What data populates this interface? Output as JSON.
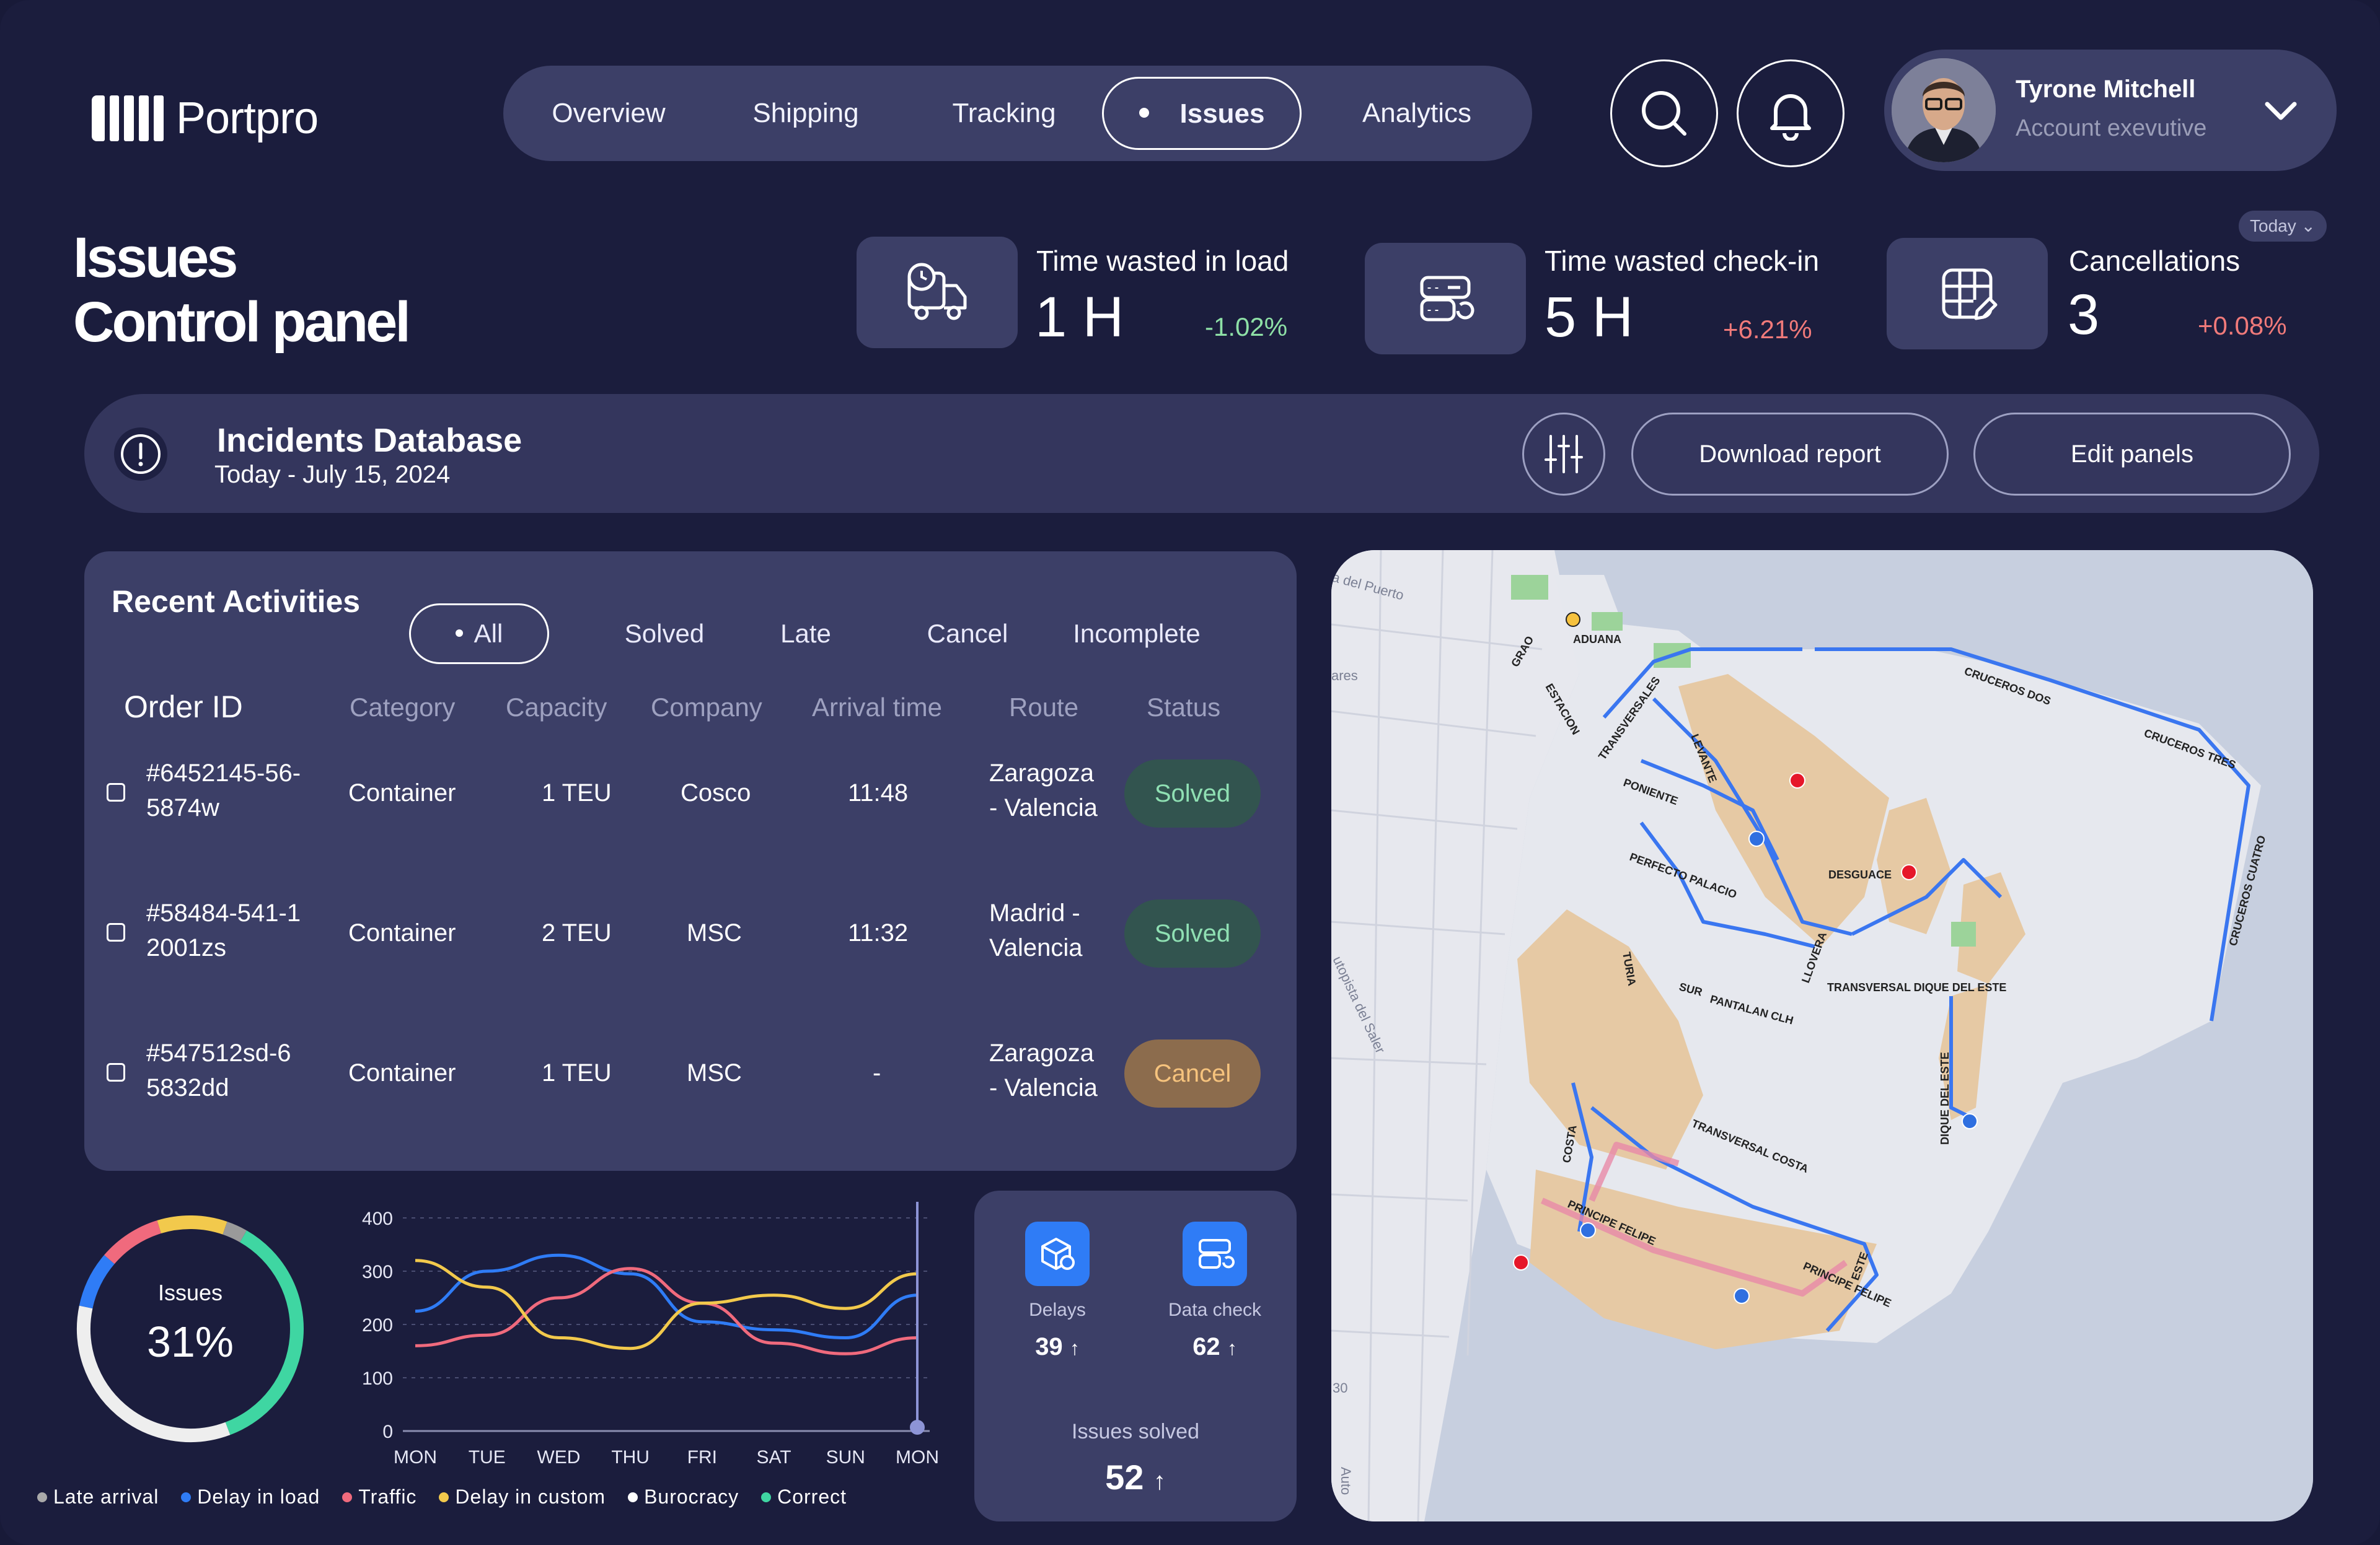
{
  "brand": {
    "name": "Portpro"
  },
  "nav": {
    "items": [
      {
        "label": "Overview"
      },
      {
        "label": "Shipping"
      },
      {
        "label": "Tracking"
      },
      {
        "label": "Issues",
        "active": true
      },
      {
        "label": "Analytics"
      }
    ]
  },
  "header": {
    "search_icon": "search-icon",
    "bell_icon": "bell-icon",
    "user": {
      "name": "Tyrone Mitchell",
      "role": "Account exevutive"
    }
  },
  "page": {
    "title_line1": "Issues",
    "title_line2": "Control panel"
  },
  "stats": {
    "period": "Today",
    "items": [
      {
        "label": "Time wasted in load",
        "value": "1 H",
        "change": "-1.02%",
        "icon": "truck-clock-icon",
        "change_color": "#8ee0a6"
      },
      {
        "label": "Time wasted check-in",
        "value": "5 H",
        "change": "+6.21%",
        "icon": "server-refresh-icon",
        "change_color": "#f07a7a"
      },
      {
        "label": "Cancellations",
        "value": "3",
        "change": "+0.08%",
        "icon": "grid-edit-icon",
        "change_color": "#f07a7a"
      }
    ]
  },
  "incidents": {
    "title": "Incidents Database",
    "subtitle": "Today - July 15, 2024",
    "download_label": "Download report",
    "edit_label": "Edit panels"
  },
  "activities": {
    "title": "Recent Activities",
    "filters": [
      "All",
      "Solved",
      "Late",
      "Cancel",
      "Incomplete"
    ],
    "columns": [
      "Order ID",
      "Category",
      "Capacity",
      "Company",
      "Arrival time",
      "Route",
      "Status"
    ],
    "rows": [
      {
        "id_line1": "#6452145-56-",
        "id_line2": "5874w",
        "category": "Container",
        "capacity": "1 TEU",
        "company": "Cosco",
        "arrival": "11:48",
        "route_line1": "Zaragoza",
        "route_line2": "- Valencia",
        "status": "Solved"
      },
      {
        "id_line1": "#58484-541-1",
        "id_line2": "2001zs",
        "category": "Container",
        "capacity": "2 TEU",
        "company": "MSC",
        "arrival": "11:32",
        "route_line1": "Madrid -",
        "route_line2": "Valencia",
        "status": "Solved"
      },
      {
        "id_line1": "#547512sd-6",
        "id_line2": "5832dd",
        "category": "Container",
        "capacity": "1 TEU",
        "company": "MSC",
        "arrival": "-",
        "route_line1": "Zaragoza",
        "route_line2": "- Valencia",
        "status": "Cancel"
      }
    ]
  },
  "issues_donut": {
    "label": "Issues",
    "value": "31%",
    "segments": [
      {
        "name": "Correct",
        "fraction": 0.36,
        "color": "#3fd6a2"
      },
      {
        "name": "Burocracy",
        "fraction": 0.34,
        "color": "#eeeeee"
      },
      {
        "name": "Delay in load",
        "fraction": 0.08,
        "color": "#2f7cf6"
      },
      {
        "name": "Traffic",
        "fraction": 0.09,
        "color": "#f06a7d"
      },
      {
        "name": "Delay in custom",
        "fraction": 0.1,
        "color": "#f2c94c"
      },
      {
        "name": "Late arrival",
        "fraction": 0.03,
        "color": "#9a9a9a"
      }
    ]
  },
  "legend": [
    {
      "label": "Late arrival",
      "color": "#a9a9a9"
    },
    {
      "label": "Delay in load",
      "color": "#2f7cf6"
    },
    {
      "label": "Traffic",
      "color": "#f06a7d"
    },
    {
      "label": "Delay in custom",
      "color": "#f2c94c"
    },
    {
      "label": "Burocracy",
      "color": "#ffffff"
    },
    {
      "label": "Correct",
      "color": "#3fd6a2"
    }
  ],
  "chart_data": {
    "type": "line",
    "categories": [
      "MON",
      "TUE",
      "WED",
      "THU",
      "FRI",
      "SAT",
      "SUN",
      "MON"
    ],
    "ylim": [
      0,
      400
    ],
    "yticks": [
      0,
      100,
      200,
      300,
      400
    ],
    "grid": true,
    "series": [
      {
        "name": "Delay in load",
        "color": "#2f7cf6",
        "values": [
          225,
          300,
          330,
          295,
          205,
          190,
          175,
          255
        ]
      },
      {
        "name": "Traffic",
        "color": "#f06a7d",
        "values": [
          160,
          180,
          250,
          305,
          240,
          165,
          145,
          175
        ]
      },
      {
        "name": "Delay in custom",
        "color": "#f2c94c",
        "values": [
          320,
          270,
          175,
          155,
          240,
          255,
          230,
          295
        ]
      }
    ],
    "highlight_index": 7
  },
  "issues_solved": {
    "delays_label": "Delays",
    "delays_value": "39",
    "datacheck_label": "Data check",
    "datacheck_value": "62",
    "solved_label": "Issues solved",
    "solved_value": "52",
    "arrow": "↑"
  },
  "map": {
    "labels": [
      "ADUANA",
      "GRAO",
      "ESTACION",
      "TRANSVERSALES",
      "LEVANTE",
      "PONIENTE",
      "PERFECTO PALACIO",
      "TURIA",
      "SUR",
      "PANTALAN CLH",
      "LLOVERA",
      "DESGUACE",
      "TRANSVERSAL DIQUE DEL ESTE",
      "DIQUE DEL ESTE",
      "CRUCEROS DOS",
      "CRUCEROS TRES",
      "CRUCEROS CUATRO",
      "TRANSVERSAL COSTA",
      "COSTA",
      "PRINCIPE FELIPE",
      "ESTE",
      "a del Puerto",
      "ares",
      "utopista del Saler",
      "30",
      "Auto"
    ]
  }
}
